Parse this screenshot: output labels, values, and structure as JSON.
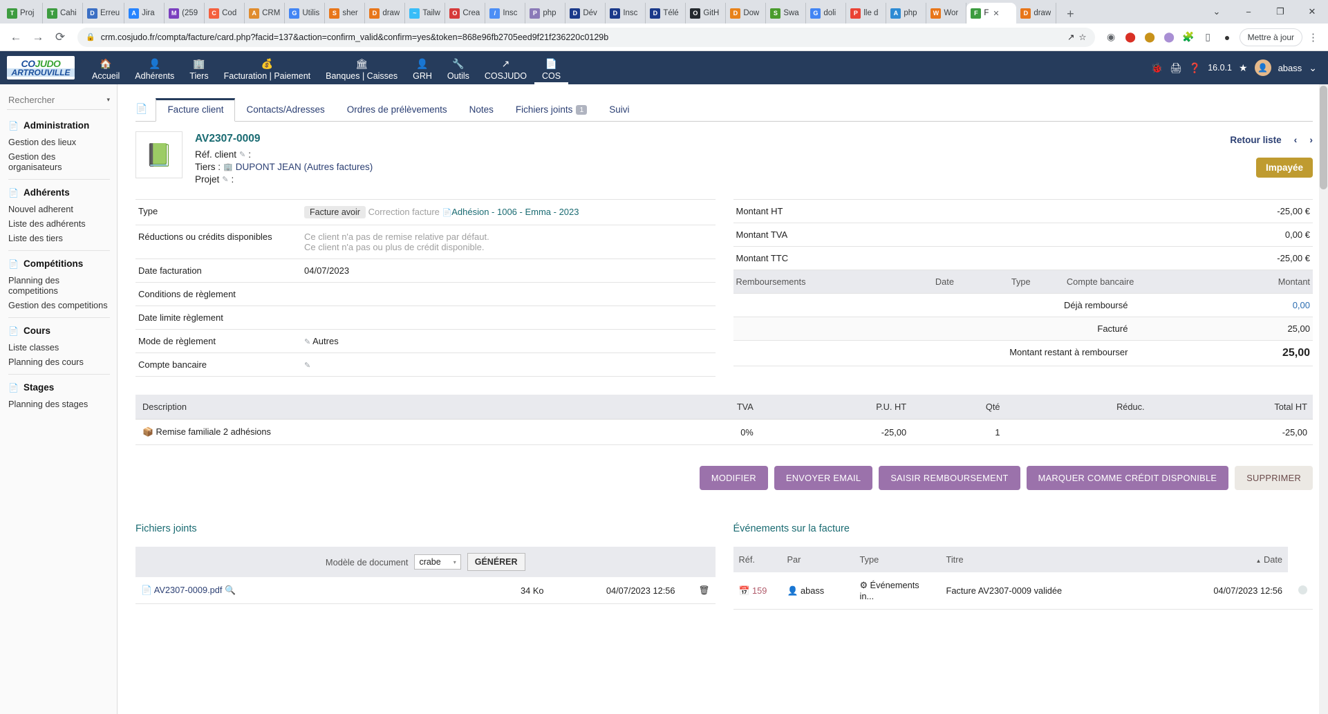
{
  "browser": {
    "tabs": [
      {
        "label": "Proj",
        "icon": "T",
        "color": "#3d9c40"
      },
      {
        "label": "Cahi",
        "icon": "T",
        "color": "#3d9c40"
      },
      {
        "label": "Erreu",
        "icon": "D",
        "color": "#3b6fc4"
      },
      {
        "label": "Jira",
        "icon": "A",
        "color": "#2684ff"
      },
      {
        "label": "(259",
        "icon": "M",
        "color": "#7b3fbf"
      },
      {
        "label": "Cod",
        "icon": "C",
        "color": "#f4603e"
      },
      {
        "label": "CRM",
        "icon": "A",
        "color": "#e08c2e"
      },
      {
        "label": "Utilis",
        "icon": "G",
        "color": "#4285f4"
      },
      {
        "label": "sher",
        "icon": "S",
        "color": "#e8761a"
      },
      {
        "label": "draw",
        "icon": "D",
        "color": "#e8761a"
      },
      {
        "label": "Tailw",
        "icon": "~",
        "color": "#38bdf8"
      },
      {
        "label": "Crea",
        "icon": "O",
        "color": "#d63a3a"
      },
      {
        "label": "Insc",
        "icon": "/",
        "color": "#4c8ef5"
      },
      {
        "label": "php",
        "icon": "P",
        "color": "#8b7ab8"
      },
      {
        "label": "Dév",
        "icon": "D",
        "color": "#1b3a8a"
      },
      {
        "label": "Insc",
        "icon": "D",
        "color": "#1b3a8a"
      },
      {
        "label": "Télé",
        "icon": "D",
        "color": "#1b3a8a"
      },
      {
        "label": "GitH",
        "icon": "O",
        "color": "#24292e"
      },
      {
        "label": "Dow",
        "icon": "D",
        "color": "#e8821a"
      },
      {
        "label": "Swa",
        "icon": "S",
        "color": "#4a9c2d"
      },
      {
        "label": "doli",
        "icon": "G",
        "color": "#4285f4"
      },
      {
        "label": "lle d",
        "icon": "P",
        "color": "#ea4335"
      },
      {
        "label": "php",
        "icon": "A",
        "color": "#2e8bd4"
      },
      {
        "label": "Wor",
        "icon": "W",
        "color": "#e8761a"
      },
      {
        "label": "F",
        "icon": "F",
        "color": "#3d9c40",
        "active": true
      },
      {
        "label": "draw",
        "icon": "D",
        "color": "#e8761a"
      }
    ],
    "new_tab_label": "+",
    "tab_close_label": "✕",
    "window_controls": [
      "⌄",
      "−",
      "❐",
      "✕"
    ],
    "nav": {
      "back": "←",
      "forward": "→",
      "reload": "⟳"
    },
    "url": "crm.cosjudo.fr/compta/facture/card.php?facid=137&action=confirm_valid&confirm=yes&token=868e96fb2705eed9f21f236220c0129b",
    "lock_icon": "🔒",
    "share_icon": "↗",
    "bookmark_icon": "☆",
    "extensions": [
      "pocket-icon",
      "adblock-icon",
      "honey-icon",
      "grammarly-icon",
      "puzzle-icon",
      "device-icon",
      "dark-reader-icon"
    ],
    "update_button": "Mettre à jour",
    "menu_icon": "⋮"
  },
  "app": {
    "logo_line1": "CO",
    "logo_line1b": "JUDO",
    "logo_line2": "ARTROUVILLE",
    "menu": [
      {
        "label": "Accueil",
        "icon": "🏠"
      },
      {
        "label": "Adhérents",
        "icon": "👤"
      },
      {
        "label": "Tiers",
        "icon": "🏢"
      },
      {
        "label": "Facturation | Paiement",
        "icon": "💰"
      },
      {
        "label": "Banques | Caisses",
        "icon": "🏛"
      },
      {
        "label": "GRH",
        "icon": "👤"
      },
      {
        "label": "Outils",
        "icon": "🔧"
      },
      {
        "label": "COSJUDO",
        "icon": "↗"
      },
      {
        "label": "COS",
        "icon": "📄",
        "active": true
      }
    ],
    "right": {
      "bug_icon": "🐞",
      "print_icon": "🖨",
      "help_icon": "❓",
      "version": "16.0.1",
      "star_icon": "★",
      "user": "abass",
      "chevron": "⌄"
    }
  },
  "sidebar": {
    "search_placeholder": "Rechercher",
    "caret": "▾",
    "groups": [
      {
        "title": "Administration",
        "icon": "📄",
        "links": [
          "Gestion des lieux",
          "Gestion des organisateurs"
        ]
      },
      {
        "title": "Adhérents",
        "icon": "📄",
        "links": [
          "Nouvel adherent",
          "Liste des adhérents",
          "Liste des tiers"
        ]
      },
      {
        "title": "Compétitions",
        "icon": "📄",
        "links": [
          "Planning des competitions",
          "Gestion des competitions"
        ]
      },
      {
        "title": "Cours",
        "icon": "📄",
        "links": [
          "Liste classes",
          "Planning des cours"
        ]
      },
      {
        "title": "Stages",
        "icon": "📄",
        "links": [
          "Planning des stages"
        ]
      }
    ]
  },
  "card": {
    "object_icon": "📄",
    "tabs": [
      {
        "label": "Facture client",
        "active": true
      },
      {
        "label": "Contacts/Adresses"
      },
      {
        "label": "Ordres de prélèvements"
      },
      {
        "label": "Notes"
      },
      {
        "label": "Fichiers joints",
        "badge": "1"
      },
      {
        "label": "Suivi"
      }
    ],
    "thumb_icon": "📗",
    "ref": "AV2307-0009",
    "ref_client_label": "Réf. client",
    "ref_client_value": ":",
    "tiers_label": "Tiers :",
    "tiers_value": "DUPONT JEAN (Autres factures)",
    "projet_label": "Projet",
    "projet_value": ":",
    "retour_liste": "Retour liste",
    "prev_arrow": "‹",
    "next_arrow": "›",
    "status_badge": "Impayée",
    "left_rows": [
      {
        "label": "Type",
        "chip": "Facture avoir",
        "muted_text": "Correction facture",
        "link": "Adhésion - 1006 - Emma - 2023"
      },
      {
        "label": "Réductions ou crédits disponibles",
        "muted_lines": [
          "Ce client n'a pas de remise relative par défaut.",
          "Ce client n'a pas ou plus de crédit disponible."
        ]
      },
      {
        "label": "Date facturation",
        "value": "04/07/2023"
      },
      {
        "label": "Conditions de règlement",
        "value": ""
      },
      {
        "label": "Date limite règlement",
        "value": ""
      },
      {
        "label": "Mode de règlement",
        "value": "Autres",
        "pencil": true
      },
      {
        "label": "Compte bancaire",
        "value": "",
        "pencil": true
      }
    ],
    "amounts": [
      {
        "label": "Montant HT",
        "value": "-25,00 €"
      },
      {
        "label": "Montant TVA",
        "value": "0,00 €"
      },
      {
        "label": "Montant TTC",
        "value": "-25,00 €"
      }
    ],
    "remb_headers": [
      "Remboursements",
      "Date",
      "Type",
      "Compte bancaire",
      "Montant"
    ],
    "remb_rows": [
      {
        "label": "Déjà remboursé",
        "value": "0,00",
        "link": true
      },
      {
        "label": "Facturé",
        "value": "25,00",
        "alt": true
      },
      {
        "label": "Montant restant à rembourser",
        "value": "25,00",
        "big": true
      }
    ],
    "lines_headers": [
      "Description",
      "TVA",
      "P.U. HT",
      "Qté",
      "Réduc.",
      "Total HT"
    ],
    "lines": [
      {
        "icon": "📦",
        "description": "Remise familiale 2 adhésions",
        "tva": "0%",
        "pu_ht": "-25,00",
        "qte": "1",
        "reduc": "",
        "total_ht": "-25,00"
      }
    ],
    "actions": [
      {
        "label": "MODIFIER",
        "style": "primary"
      },
      {
        "label": "ENVOYER EMAIL",
        "style": "primary"
      },
      {
        "label": "SAISIR REMBOURSEMENT",
        "style": "primary"
      },
      {
        "label": "MARQUER COMME CRÉDIT DISPONIBLE",
        "style": "primary"
      },
      {
        "label": "SUPPRIMER",
        "style": "grey"
      }
    ]
  },
  "attachments": {
    "title": "Fichiers joints",
    "model_label": "Modèle de document",
    "model_value": "crabe",
    "model_caret": "▾",
    "generate_button": "GÉNÉRER",
    "files": [
      {
        "icon": "📄",
        "name": "AV2307-0009.pdf",
        "zoom_icon": "🔍",
        "size": "34 Ko",
        "date": "04/07/2023 12:56",
        "delete_icon": "🗑"
      }
    ]
  },
  "events": {
    "title": "Événements sur la facture",
    "headers": [
      "Réf.",
      "Par",
      "Type",
      "Titre",
      "Date"
    ],
    "sort_caret": "▲",
    "rows": [
      {
        "ref_icon": "📅",
        "ref": "159",
        "user_icon": "👤",
        "par": "abass",
        "type_icon": "⚙",
        "type": "Événements in...",
        "titre": "Facture AV2307-0009 validée",
        "date": "04/07/2023 12:56"
      }
    ]
  }
}
